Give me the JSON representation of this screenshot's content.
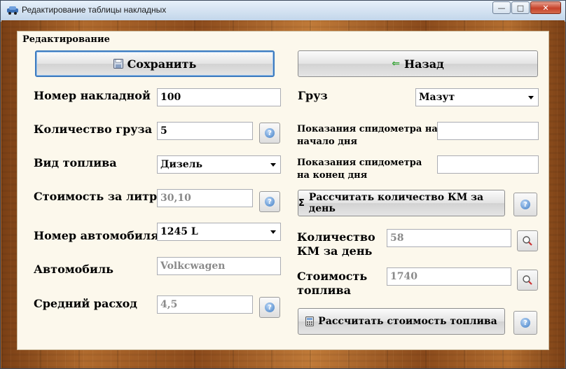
{
  "window": {
    "title": "Редактирование таблицы накладных"
  },
  "panel": {
    "title": "Редактирование"
  },
  "buttons": {
    "save": "Сохранить",
    "back": "Назад",
    "calc_km": "Рассчитать количество КМ за  день",
    "calc_cost": "Рассчитать стоимость топлива"
  },
  "fields": {
    "invoice_number": {
      "label": "Номер накладной",
      "value": "100"
    },
    "cargo_quantity": {
      "label": "Количество груза",
      "value": "5"
    },
    "fuel_type": {
      "label": "Вид топлива",
      "value": "Дизель"
    },
    "price_per_liter": {
      "label": "Стоимость за литр",
      "value": "30,10"
    },
    "car_number": {
      "label": "Номер автомобиля",
      "value": "1245 L"
    },
    "car": {
      "label": "Автомобиль",
      "value": "Volkcwagen"
    },
    "avg_consumption": {
      "label": "Средний расход",
      "value": "4,5"
    },
    "cargo": {
      "label": "Груз",
      "value": "Мазут"
    },
    "odo_start": {
      "label_line1": "Показания спидометра на",
      "label_line2": "начало дня",
      "value": ""
    },
    "odo_end": {
      "label_line1": "Показания спидометра",
      "label_line2": "на конец дня",
      "value": ""
    },
    "km_per_day": {
      "label_line1": "Количество",
      "label_line2": "КМ за день",
      "value": "58"
    },
    "fuel_cost": {
      "label_line1": "Стоимость",
      "label_line2": "топлива",
      "value": "1740"
    }
  },
  "icons": {
    "help": "help-icon",
    "zoom": "zoom-icon",
    "save": "floppy-disk-icon",
    "back": "arrow-left-icon",
    "sigma": "sigma-icon",
    "calculator": "calculator-icon"
  },
  "colors": {
    "accent": "#3d7bbf",
    "panel_bg": "#fcf8ec",
    "readonly_text": "#8a8a8a"
  }
}
